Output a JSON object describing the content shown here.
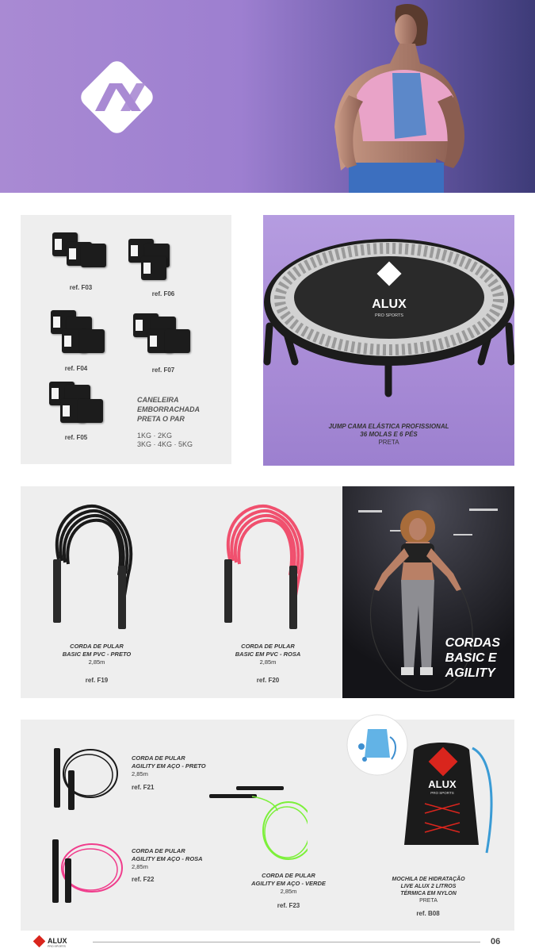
{
  "brand": {
    "name": "ALUX",
    "tagline": "PRO SPORTS",
    "accent": "#a98ad3",
    "red": "#d9251d"
  },
  "ankle_weights": {
    "refs": [
      "ref. F03",
      "ref. F06",
      "ref. F04",
      "ref. F07",
      "ref. F05"
    ],
    "title_lines": [
      "CANELEIRA",
      "EMBORRACHADA",
      "PRETA O PAR"
    ],
    "weights_line1": "1KG · 2KG",
    "weights_line2": "3KG · 4KG · 5KG"
  },
  "trampoline": {
    "title_line1": "JUMP CAMA ELÁSTICA PROFISSIONAL",
    "title_line2": "36 MOLAS E 6 PÉS",
    "color": "PRETA"
  },
  "basic_ropes": [
    {
      "line1": "CORDA DE PULAR",
      "line2": "BASIC EM PVC - PRETO",
      "size": "2,85m",
      "ref": "ref. F19",
      "color": "#1a1a1a"
    },
    {
      "line1": "CORDA DE PULAR",
      "line2": "BASIC EM PVC - ROSA",
      "size": "2,85m",
      "ref": "ref. F20",
      "color": "#f0506e"
    }
  ],
  "ropes_photo": {
    "text_lines": [
      "CORDAS",
      "BASIC E",
      "AGILITY"
    ]
  },
  "agility_ropes": [
    {
      "line1": "CORDA DE PULAR",
      "line2": "AGILITY EM AÇO - PRETO",
      "size": "2,85m",
      "ref": "ref. F21",
      "color": "#1a1a1a"
    },
    {
      "line1": "CORDA DE PULAR",
      "line2": "AGILITY EM AÇO - ROSA",
      "size": "2,85m",
      "ref": "ref. F22",
      "color": "#f03d8c"
    },
    {
      "line1": "CORDA DE PULAR",
      "line2": "AGILITY EM AÇO - VERDE",
      "size": "2,85m",
      "ref": "ref. F23",
      "color": "#7cf03a"
    }
  ],
  "backpack": {
    "line1": "MOCHILA DE HIDRATAÇÃO",
    "line2": "LIVE ALUX 2 LITROS",
    "line3": "TÉRMICA EM NYLON",
    "color": "PRETA",
    "ref": "ref. B08"
  },
  "footer": {
    "page_number": "06"
  }
}
